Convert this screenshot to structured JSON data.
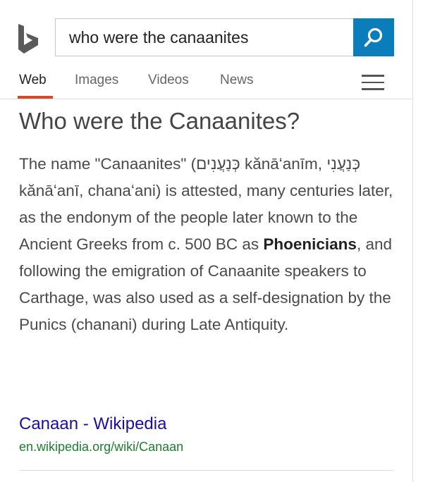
{
  "search": {
    "query": "who were the canaanites"
  },
  "tabs": [
    {
      "label": "Web",
      "active": true
    },
    {
      "label": "Images",
      "active": false
    },
    {
      "label": "Videos",
      "active": false
    },
    {
      "label": "News",
      "active": false
    }
  ],
  "answer": {
    "title": "Who were the Canaanites?",
    "body_parts": [
      "The name \"Canaanites\" (כְּנַעֲנִים kănāʻanīm, כְּנַעֲנִי kănāʻanī, chanaʻani) is attested, many centuries later, as the endonym of the people later known to the Ancient Greeks from c. 500 BC as ",
      "Phoenicians",
      ", and following the emigration of Canaanite speakers to Carthage, was also used as a self-designation by the Punics (chanani) during Late Antiquity."
    ],
    "source_title": "Canaan - Wikipedia",
    "source_url": "en.wikipedia.org/wiki/Canaan"
  },
  "colors": {
    "accent": "#0b7dba",
    "tab_underline": "#d5492a",
    "link": "#1a0dab",
    "url": "#1e7d32"
  },
  "icons": {
    "logo": "bing-logo",
    "search": "search-icon",
    "menu": "hamburger-menu-icon"
  }
}
